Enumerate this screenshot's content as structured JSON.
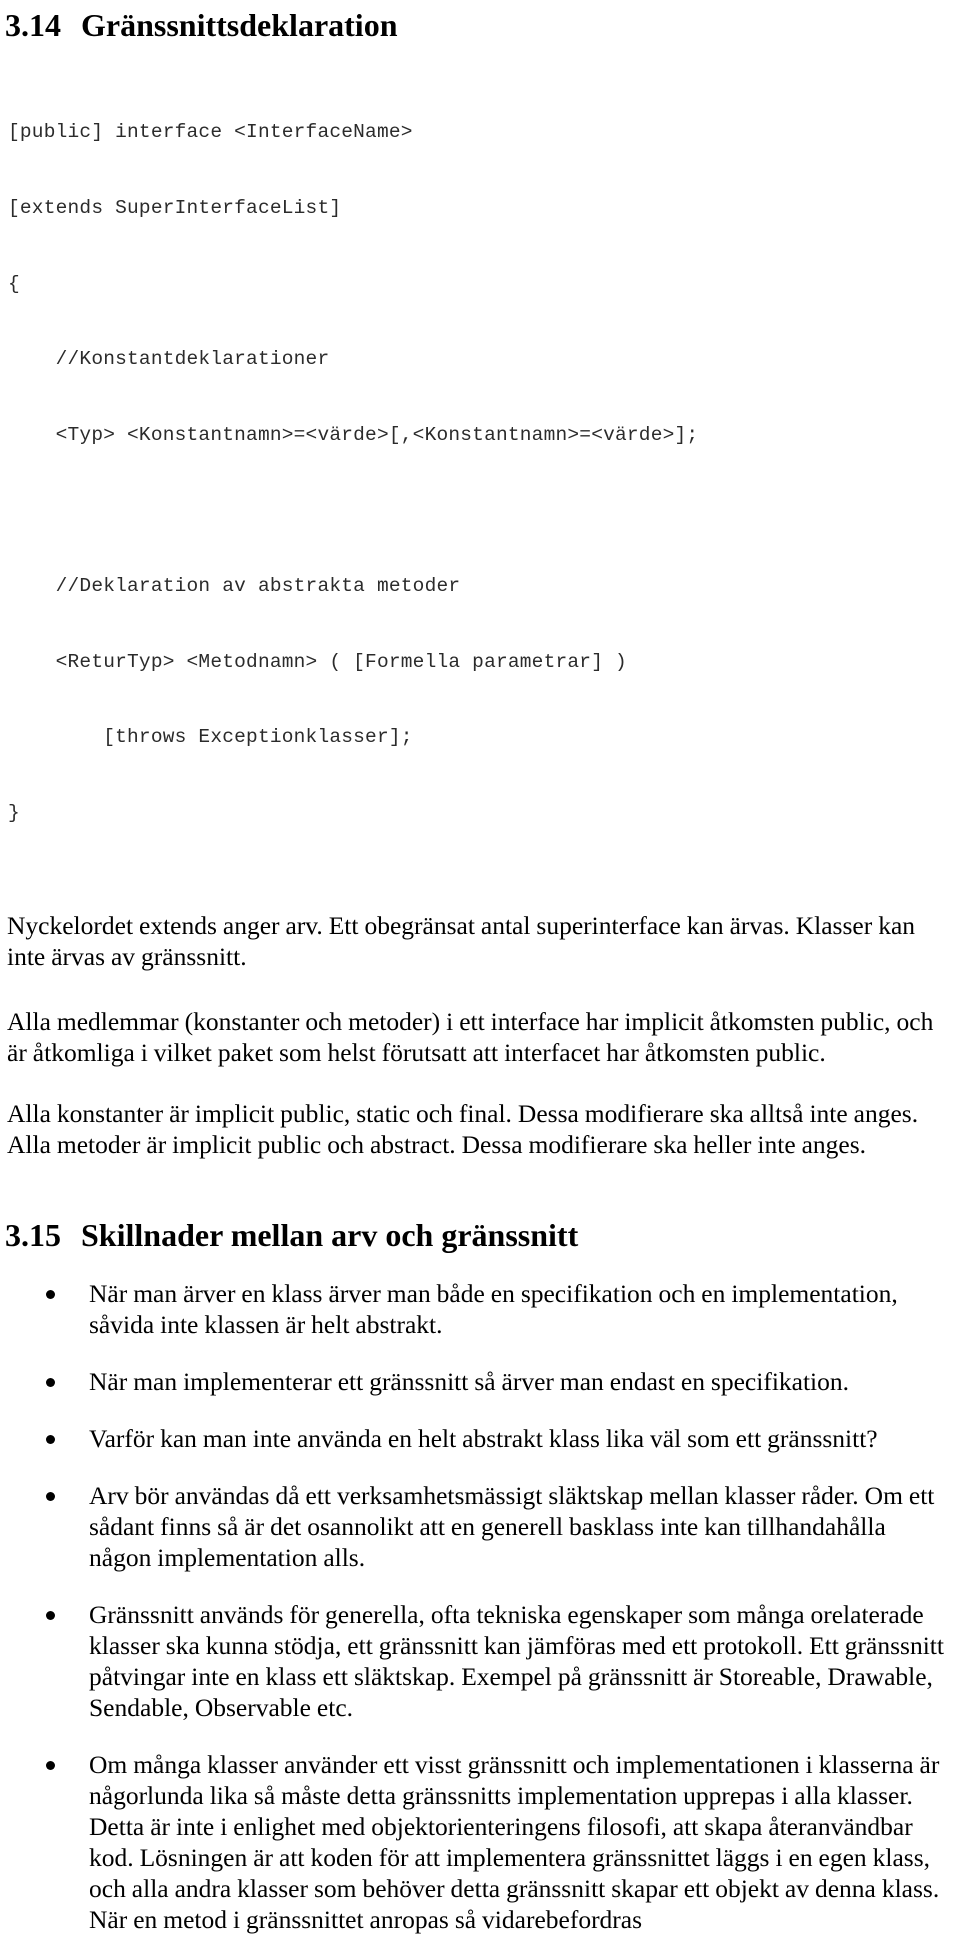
{
  "document": {
    "language": "sv",
    "text_color": "#000000",
    "code_color": "#2b2b2b",
    "background": "#ffffff"
  },
  "section_314": {
    "number": "3.14",
    "title": "Gränssnittsdeklaration",
    "code_lines": [
      "[public] interface <InterfaceName>",
      "[extends SuperInterfaceList]",
      "{",
      "    //Konstantdeklarationer",
      "    <Typ> <Konstantnamn>=<värde>[,<Konstantnamn>=<värde>];",
      "",
      "    //Deklaration av abstrakta metoder",
      "    <ReturTyp> <Metodnamn> ( [Formella parametrar] )",
      "        [throws Exceptionklasser];",
      "}"
    ],
    "paragraphs": [
      "Nyckelordet extends anger arv. Ett obegränsat antal superinterface kan ärvas. Klasser kan inte ärvas av gränssnitt.",
      "Alla medlemmar (konstanter och metoder) i ett interface har implicit åtkomsten public, och är åtkomliga i vilket paket som helst förutsatt att interfacet har åtkomsten public.",
      "Alla konstanter är implicit public, static och final. Dessa modifierare ska alltså inte anges. Alla metoder är implicit public och abstract. Dessa modifierare ska heller inte anges."
    ]
  },
  "section_315": {
    "number": "3.15",
    "title": "Skillnader mellan arv och gränssnitt",
    "bullets": [
      "När man ärver en klass ärver man både en specifikation och en implementation, såvida inte klassen är helt abstrakt.",
      "När man implementerar ett gränssnitt så ärver man endast en specifikation.",
      "Varför kan man inte använda en helt abstrakt klass lika väl som ett gränssnitt?",
      "Arv bör användas då ett verksamhetsmässigt släktskap mellan klasser råder. Om ett sådant finns så är det osannolikt att en generell basklass inte kan tillhandahålla någon implementation alls.",
      "Gränssnitt används för generella, ofta tekniska egenskaper som många orelaterade klasser ska kunna stödja, ett gränssnitt kan jämföras med ett protokoll. Ett gränssnitt påtvingar inte en klass ett släktskap. Exempel på gränssnitt är Storeable, Drawable, Sendable, Observable etc.",
      "Om många klasser använder ett visst gränssnitt och implementationen i klasserna är någorlunda lika så måste  detta gränssnitts implementation upprepas i alla klasser. Detta är inte i enlighet med objektorienteringens filosofi, att skapa återanvändbar kod. Lösningen är att koden för att implementera gränssnittet läggs i en egen klass, och alla andra klasser som behöver detta gränssnitt skapar ett objekt av denna klass. När en metod i gränssnittet anropas så vidarebefordras"
    ]
  }
}
